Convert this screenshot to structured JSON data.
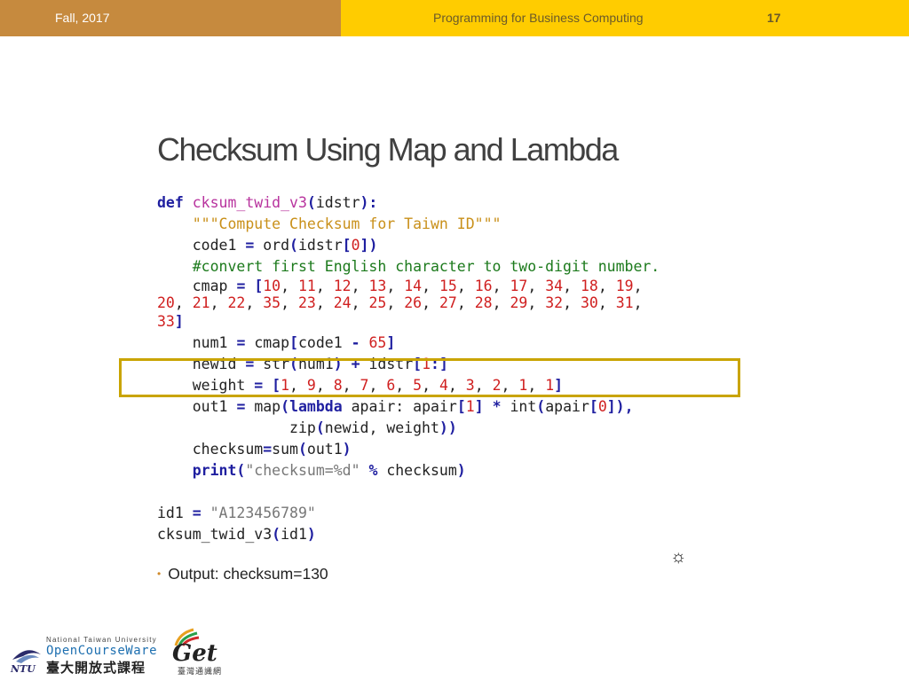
{
  "header": {
    "term": "Fall, 2017",
    "course": "Programming for Business Computing",
    "page_number": "17"
  },
  "slide": {
    "title": "Checksum Using Map and Lambda",
    "output_bullet": "Output: checksum=130"
  },
  "code": {
    "def_kw": "def",
    "func_name": "cksum_twid_v3",
    "param": "idstr",
    "docstring": "\"\"\"Compute Checksum for Taiwn ID\"\"\"",
    "code1_lhs": "code1",
    "ord_call": "ord",
    "idx0": "0",
    "comment": "#convert first English character to two-digit number.",
    "cmap_name": "cmap",
    "cmap_values": [
      "10",
      "11",
      "12",
      "13",
      "14",
      "15",
      "16",
      "17",
      "34",
      "18",
      "19",
      "20",
      "21",
      "22",
      "35",
      "23",
      "24",
      "25",
      "26",
      "27",
      "28",
      "29",
      "32",
      "30",
      "31",
      "33"
    ],
    "num1_name": "num1",
    "minus_val": "65",
    "newid_name": "newid",
    "str_call": "str",
    "slice_start": "1",
    "weight_name": "weight",
    "weight_values": [
      "1",
      "9",
      "8",
      "7",
      "6",
      "5",
      "4",
      "3",
      "2",
      "1",
      "1"
    ],
    "out1_name": "out1",
    "map_call": "map",
    "lambda_kw": "lambda",
    "apair": "apair",
    "int_call": "int",
    "zip_call": "zip",
    "newid_arg": "newid",
    "weight_arg": "weight",
    "checksum_name": "checksum",
    "sum_call": "sum",
    "print_kw": "print",
    "format_str": "\"checksum=%d\"",
    "id1_name": "id1",
    "id1_value": "\"A123456789\""
  },
  "colors": {
    "header_left": "#c68a3e",
    "header_right": "#ffcc00",
    "highlight_box": "#c9a400",
    "keyword": "#1f1fa0",
    "number": "#d02020",
    "comment": "#1c7a1c",
    "string": "#c9901a"
  },
  "icons": {
    "settings": "gear-icon",
    "bullet": "bullet-dot"
  },
  "logos": {
    "ntu_university": "National Taiwan University",
    "ocw_name": "OpenCourseWare",
    "ocw_chinese": "臺大開放式課程",
    "get_mark": "Get",
    "get_chinese": "臺灣通識網"
  }
}
